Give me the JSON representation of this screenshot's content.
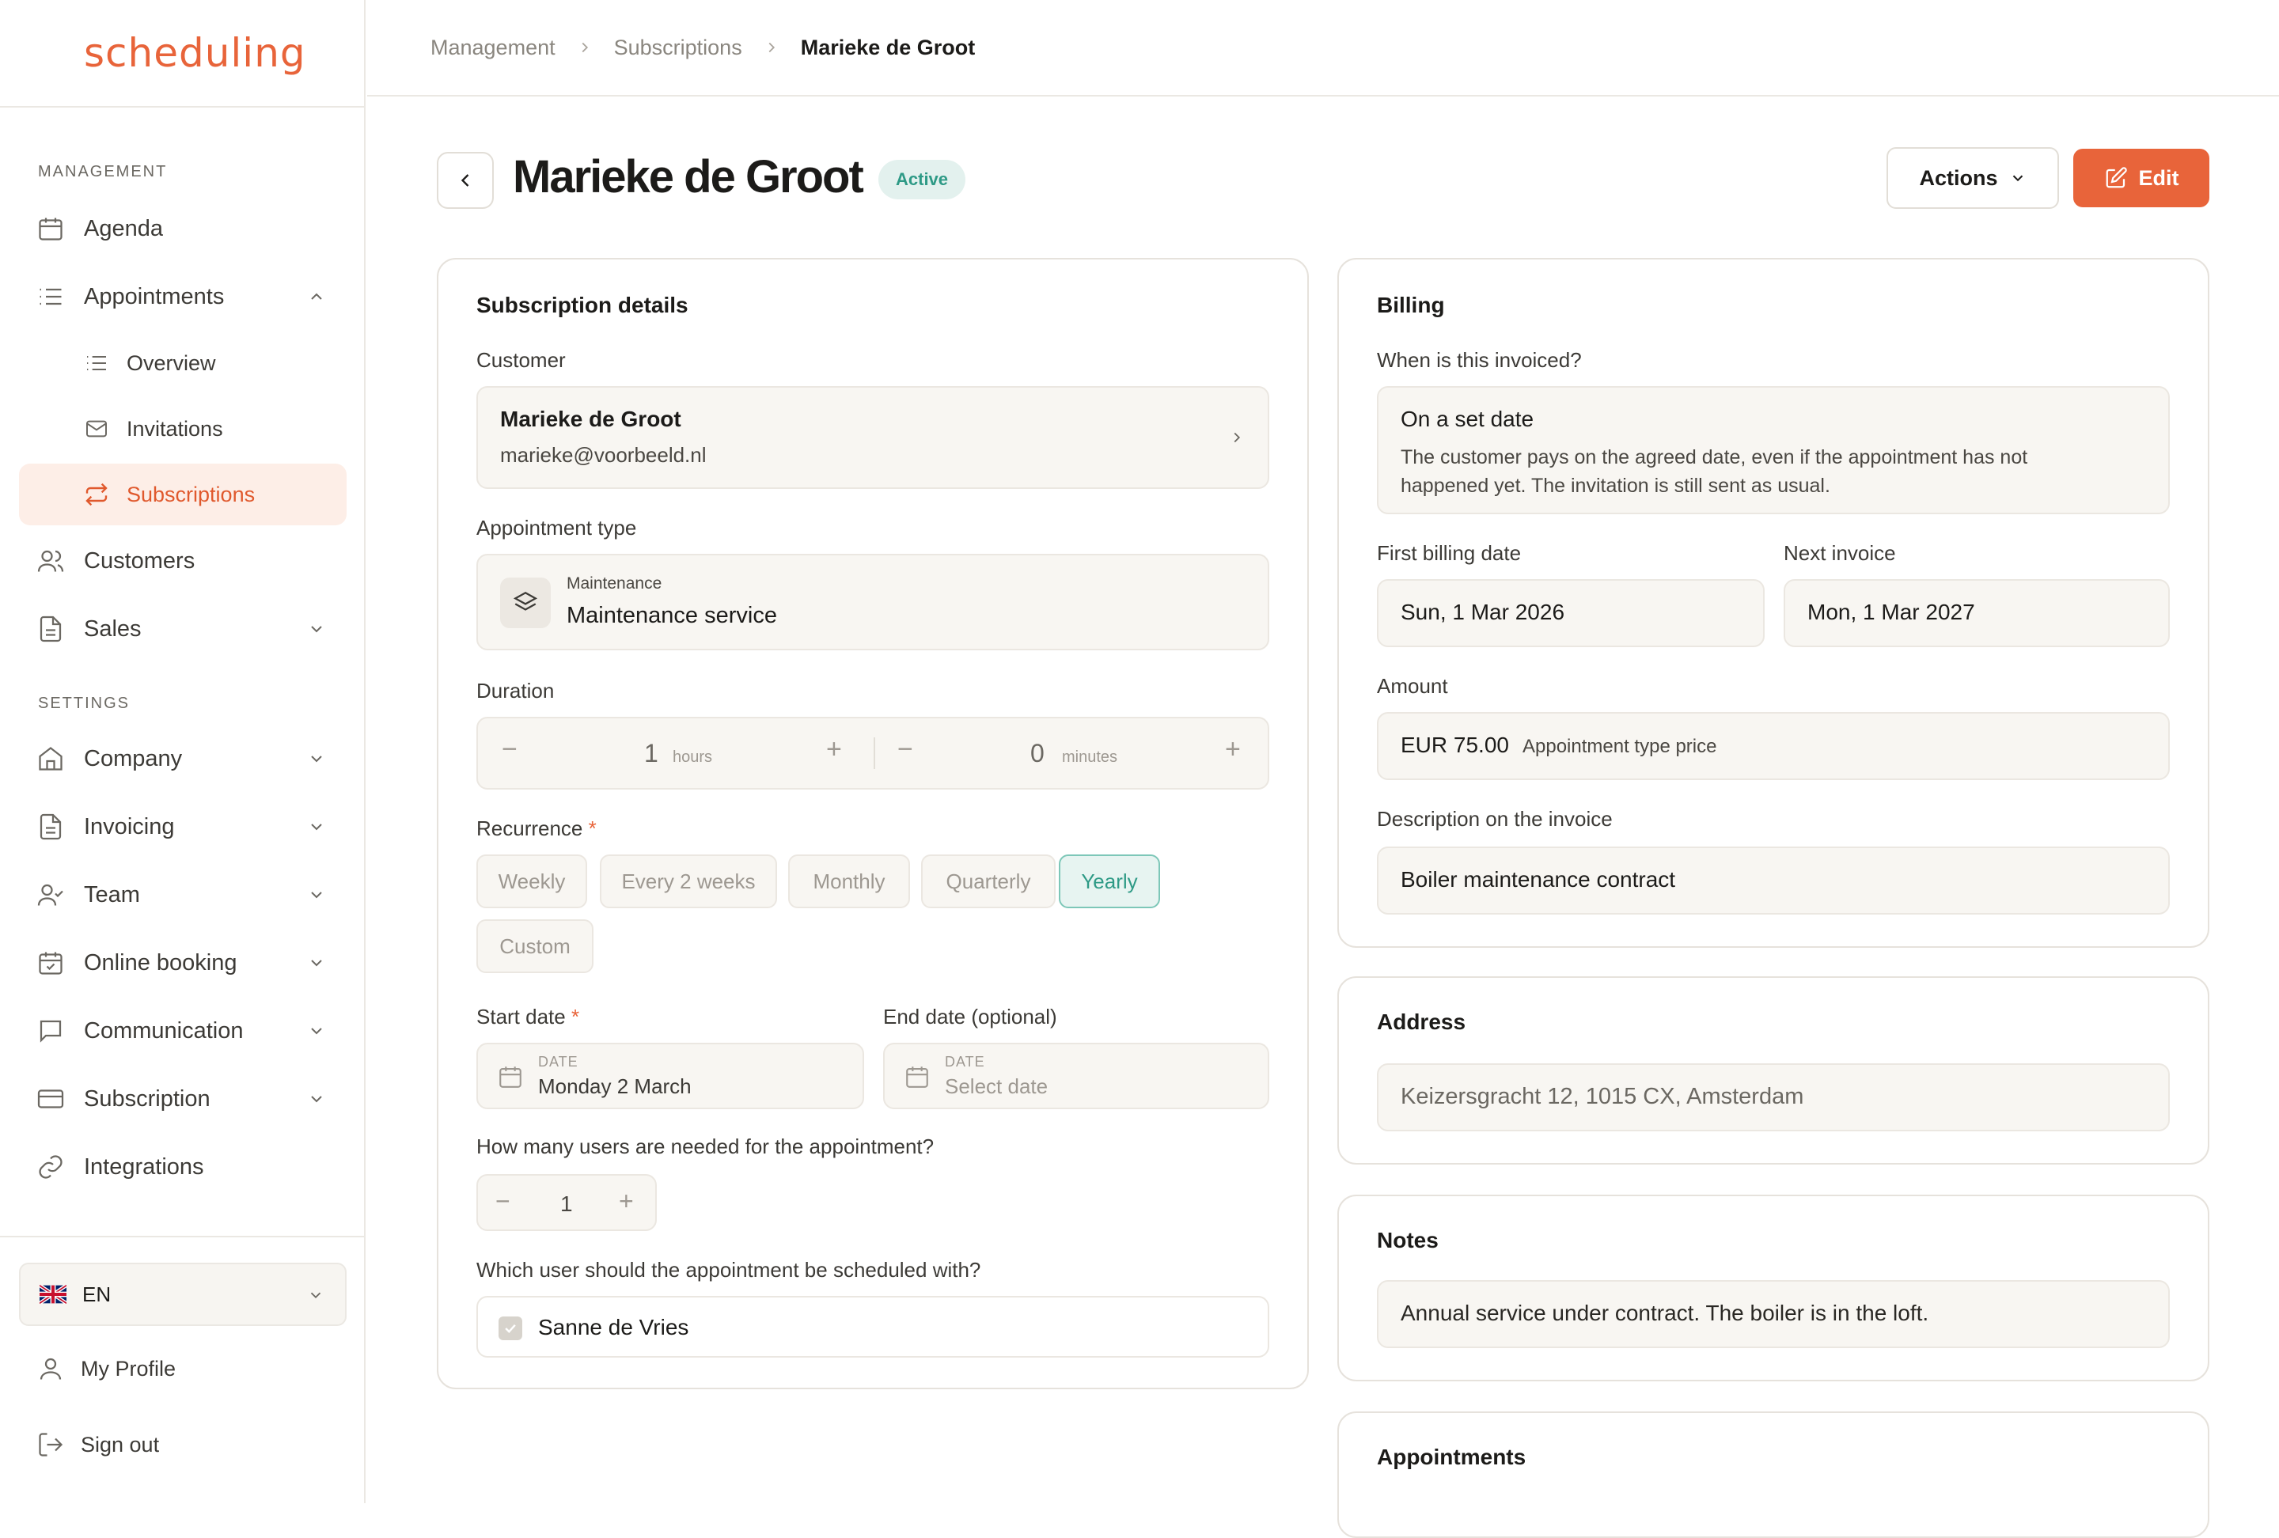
{
  "app": {
    "logo": "scheduling"
  },
  "sidebar": {
    "management_label": "MANAGEMENT",
    "settings_label": "SETTINGS",
    "items": {
      "agenda": "Agenda",
      "appointments": "Appointments",
      "overview": "Overview",
      "invitations": "Invitations",
      "subscriptions": "Subscriptions",
      "customers": "Customers",
      "sales": "Sales",
      "company": "Company",
      "invoicing": "Invoicing",
      "team": "Team",
      "online_booking": "Online booking",
      "communication": "Communication",
      "subscription": "Subscription",
      "integrations": "Integrations"
    },
    "language": "EN",
    "my_profile": "My Profile",
    "sign_out": "Sign out"
  },
  "breadcrumb": {
    "level1": "Management",
    "level2": "Subscriptions",
    "current": "Marieke de Groot"
  },
  "header": {
    "title": "Marieke de Groot",
    "status": "Active",
    "actions_label": "Actions",
    "edit_label": "Edit"
  },
  "details": {
    "heading": "Subscription details",
    "customer_label": "Customer",
    "customer_name": "Marieke de Groot",
    "customer_email": "marieke@voorbeeld.nl",
    "appt_type_label": "Appointment type",
    "appt_category": "Maintenance",
    "appt_name": "Maintenance service",
    "duration_label": "Duration",
    "hours_value": "1",
    "hours_unit": "hours",
    "minutes_value": "0",
    "minutes_unit": "minutes",
    "recurrence_label": "Recurrence",
    "required_mark": "*",
    "recurrence_options": [
      "Weekly",
      "Every 2 weeks",
      "Monthly",
      "Quarterly",
      "Yearly",
      "Custom"
    ],
    "recurrence_selected": "Yearly",
    "start_label": "Start date",
    "end_label": "End date (optional)",
    "date_caption": "DATE",
    "start_value": "Monday 2 March",
    "end_placeholder": "Select date",
    "users_needed_label": "How many users are needed for the appointment?",
    "users_needed_value": "1",
    "which_user_label": "Which user should the appointment be scheduled with?",
    "user_name": "Sanne de Vries"
  },
  "billing": {
    "heading": "Billing",
    "when_label": "When is this invoiced?",
    "when_title": "On a set date",
    "when_desc_line1": "The customer pays on the agreed date, even if the appointment has not",
    "when_desc_line2": "happened yet. The invitation is still sent as usual.",
    "first_label": "First billing date",
    "first_value": "Sun, 1 Mar 2026",
    "next_label": "Next invoice",
    "next_value": "Mon, 1 Mar 2027",
    "amount_label": "Amount",
    "amount_value": "EUR 75.00",
    "amount_note": "Appointment type price",
    "desc_label": "Description on the invoice",
    "desc_value": "Boiler maintenance contract"
  },
  "address": {
    "heading": "Address",
    "value": "Keizersgracht 12, 1015 CX, Amsterdam"
  },
  "notes": {
    "heading": "Notes",
    "value": "Annual service under contract. The boiler is in the loft."
  },
  "appointments": {
    "heading": "Appointments"
  },
  "colors": {
    "accent": "#e8643a",
    "active_green": "#2e9a86",
    "field_bg": "#f8f6f2",
    "border": "#e6e2dc"
  }
}
